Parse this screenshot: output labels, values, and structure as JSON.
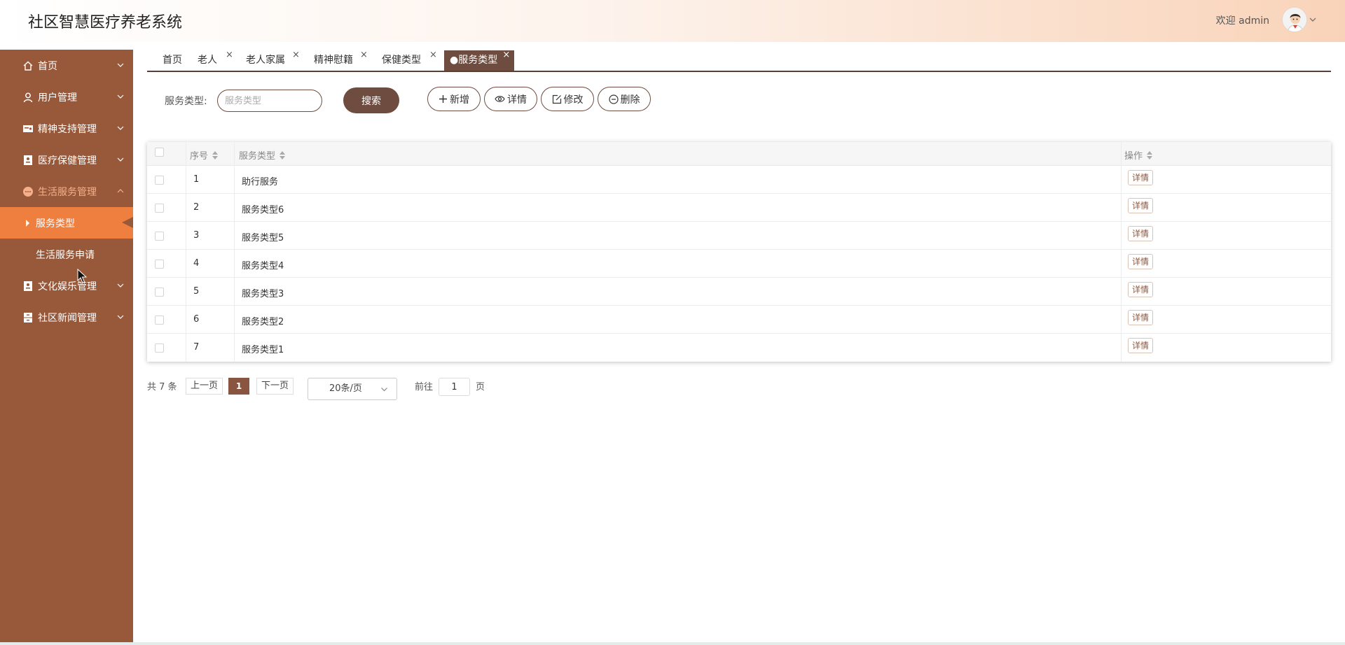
{
  "header": {
    "app_title": "社区智慧医疗养老系统",
    "welcome_text": "欢迎 admin",
    "avatar_icon": "user-avatar-icon"
  },
  "sidebar": {
    "items": [
      {
        "label": "首页",
        "icon": "home-icon"
      },
      {
        "label": "用户管理",
        "icon": "user-icon"
      },
      {
        "label": "精神支持管理",
        "icon": "card-icon"
      },
      {
        "label": "医疗保健管理",
        "icon": "id-badge-icon"
      },
      {
        "label": "生活服务管理",
        "icon": "smile-icon",
        "expanded": true,
        "children": [
          {
            "label": "服务类型",
            "active": true
          },
          {
            "label": "生活服务申请"
          }
        ]
      },
      {
        "label": "文化娱乐管理",
        "icon": "id-badge-icon"
      },
      {
        "label": "社区新闻管理",
        "icon": "archive-icon"
      }
    ]
  },
  "tabs": [
    {
      "label": "首页"
    },
    {
      "label": "老人",
      "closable": true
    },
    {
      "label": "老人家属",
      "closable": true
    },
    {
      "label": "精神慰籍",
      "closable": true
    },
    {
      "label": "保健类型",
      "closable": true
    },
    {
      "label": "●服务类型",
      "closable": true,
      "active": true
    }
  ],
  "tab_close_glyph": "×",
  "filter": {
    "label": "服务类型:",
    "placeholder": "服务类型",
    "search_label": "搜索"
  },
  "actions": {
    "add": "新增",
    "detail": "详情",
    "edit": "修改",
    "delete": "删除"
  },
  "table": {
    "columns": [
      "序号",
      "服务类型",
      "操作"
    ],
    "rows": [
      {
        "index": "1",
        "type": "助行服务",
        "action": "详情"
      },
      {
        "index": "2",
        "type": "服务类型6",
        "action": "详情"
      },
      {
        "index": "3",
        "type": "服务类型5",
        "action": "详情"
      },
      {
        "index": "4",
        "type": "服务类型4",
        "action": "详情"
      },
      {
        "index": "5",
        "type": "服务类型3",
        "action": "详情"
      },
      {
        "index": "6",
        "type": "服务类型2",
        "action": "详情"
      },
      {
        "index": "7",
        "type": "服务类型1",
        "action": "详情"
      }
    ]
  },
  "pagination": {
    "total": "共 7 条",
    "prev": "上一页",
    "current": "1",
    "next": "下一页",
    "page_size": "20条/页",
    "goto_label": "前往",
    "goto_value": "1",
    "page_suffix": "页"
  },
  "colors": {
    "sidebar_bg": "#98583a",
    "active_menu": "#ee7f3f",
    "primary": "#6e4c40",
    "header_gradient_end": "#f9d3b9"
  }
}
